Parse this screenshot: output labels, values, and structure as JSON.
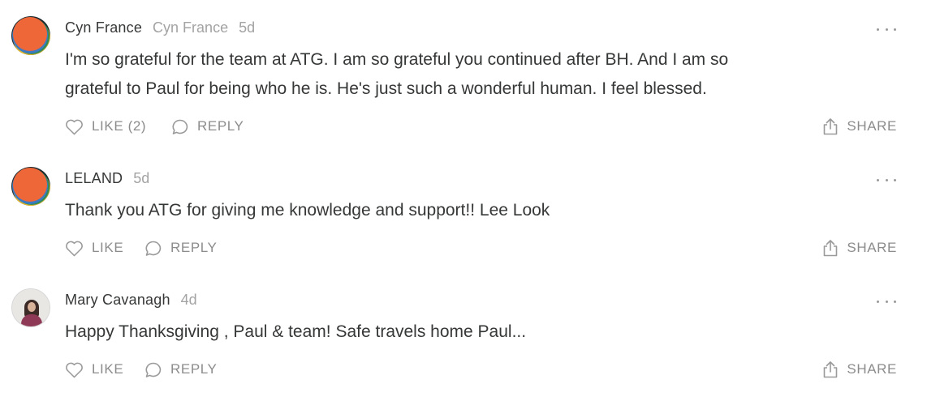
{
  "comments": [
    {
      "author": "Cyn France",
      "handle": "Cyn France",
      "time": "5d",
      "avatar": "orange-circle-logo-avatar",
      "text_lines": [
        "I'm so grateful for the team at ATG. I am so grateful you continued after BH. And I am so",
        "grateful to Paul for being who he is. He's just such a wonderful human. I feel blessed."
      ],
      "like_label": "LIKE (2)",
      "reply_label": "REPLY",
      "share_label": "SHARE"
    },
    {
      "author": "LELAND",
      "time": "5d",
      "avatar": "orange-circle-logo-avatar",
      "text_lines": [
        "Thank you ATG for giving me knowledge and support!! Lee Look"
      ],
      "like_label": "LIKE",
      "reply_label": "REPLY",
      "share_label": "SHARE"
    },
    {
      "author": "Mary Cavanagh",
      "time": "4d",
      "avatar": "profile-photo-avatar",
      "text_lines": [
        "Happy Thanksgiving , Paul & team! Safe travels home Paul..."
      ],
      "like_label": "LIKE",
      "reply_label": "REPLY",
      "share_label": "SHARE"
    }
  ],
  "icons": {
    "like": "heart-outline-icon",
    "reply": "speech-bubble-icon",
    "share": "share-arrow-icon",
    "more": "ellipsis-icon"
  },
  "colors": {
    "text": "#363737",
    "muted": "#a3a3a3",
    "action": "#8c8c8c",
    "avatar_orange": "#ee6739"
  }
}
